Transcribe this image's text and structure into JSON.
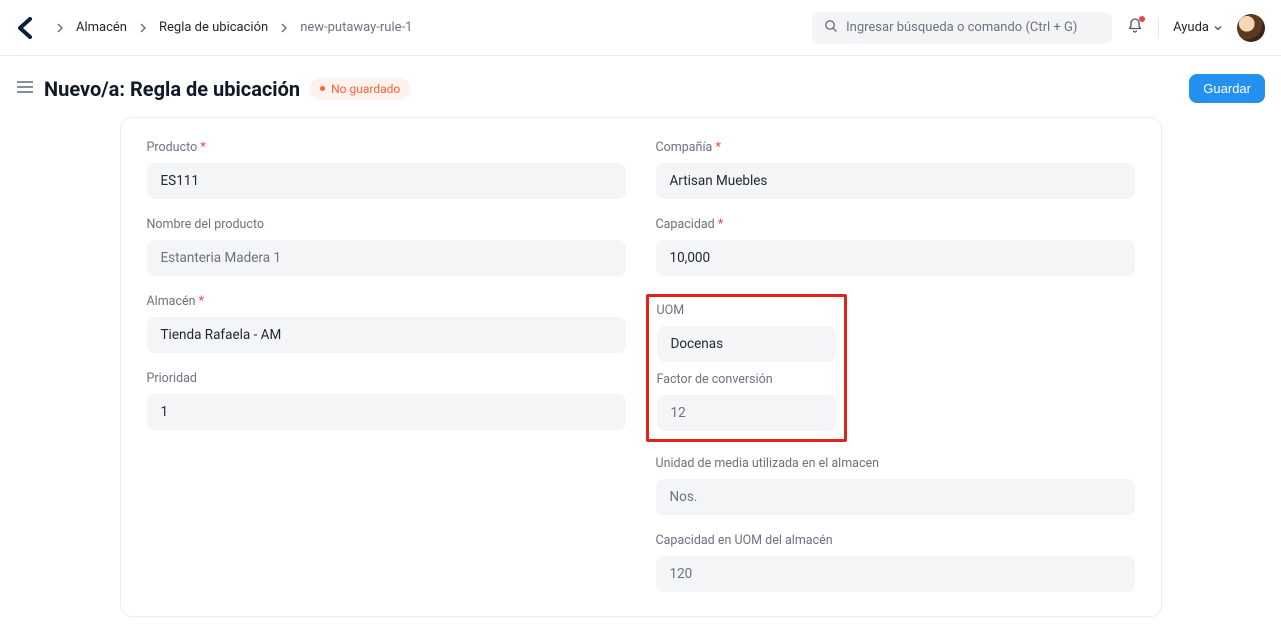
{
  "breadcrumb": {
    "items": [
      "Almacén",
      "Regla de ubicación",
      "new-putaway-rule-1"
    ]
  },
  "search": {
    "placeholder": "Ingresar búsqueda o comando (Ctrl + G)"
  },
  "help_label": "Ayuda",
  "page": {
    "title": "Nuevo/a: Regla de ubicación",
    "unsaved_label": "No guardado",
    "save_label": "Guardar"
  },
  "form": {
    "left": {
      "product": {
        "label": "Producto",
        "value": "ES111",
        "required": true
      },
      "product_name": {
        "label": "Nombre del producto",
        "value": "Estanteria Madera 1",
        "required": false
      },
      "warehouse": {
        "label": "Almacén",
        "value": "Tienda Rafaela - AM",
        "required": true
      },
      "priority": {
        "label": "Prioridad",
        "value": "1",
        "required": false
      }
    },
    "right": {
      "company": {
        "label": "Compañía",
        "value": "Artisan Muebles",
        "required": true
      },
      "capacity": {
        "label": "Capacidad",
        "value": "10,000",
        "required": true
      },
      "uom": {
        "label": "UOM",
        "value": "Docenas",
        "required": false
      },
      "conv_factor": {
        "label": "Factor de conversión",
        "value": "12",
        "required": false
      },
      "stock_uom": {
        "label": "Unidad de media utilizada en el almacen",
        "value": "Nos.",
        "required": false
      },
      "cap_stock_uom": {
        "label": "Capacidad en UOM del almacén",
        "value": "120",
        "required": false
      }
    }
  }
}
